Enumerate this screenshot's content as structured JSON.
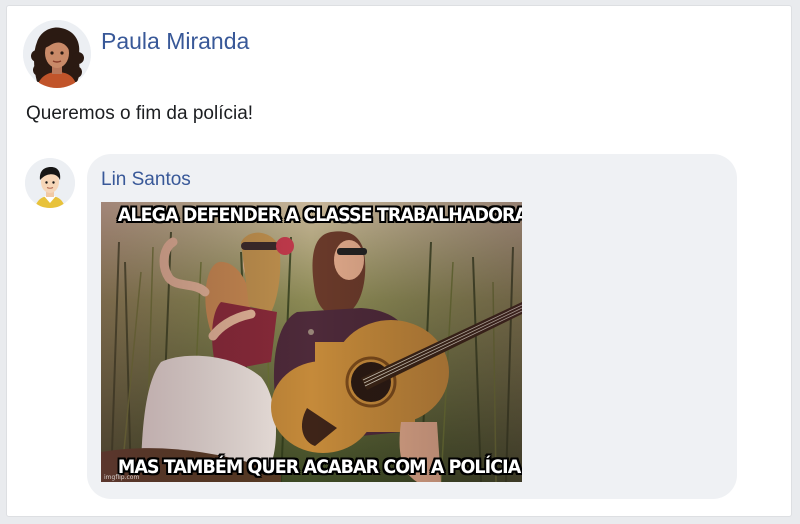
{
  "post": {
    "author": {
      "name": "Paula Miranda",
      "avatar_icon": "woman-curly-hair-avatar-icon"
    },
    "text": "Queremos o fim da polícia!"
  },
  "comment": {
    "author": {
      "name": "Lin Santos",
      "avatar_icon": "man-black-hair-avatar-icon"
    },
    "meme": {
      "top_caption": "ALEGA DEFENDER A CLASSE TRABALHADORA",
      "bottom_caption": "MAS TAMBÉM QUER ACABAR COM A POLÍCIA",
      "watermark": "imgflip.com"
    }
  },
  "colors": {
    "link": "#385898",
    "bubble": "#eff1f4",
    "text": "#1c1e21"
  }
}
